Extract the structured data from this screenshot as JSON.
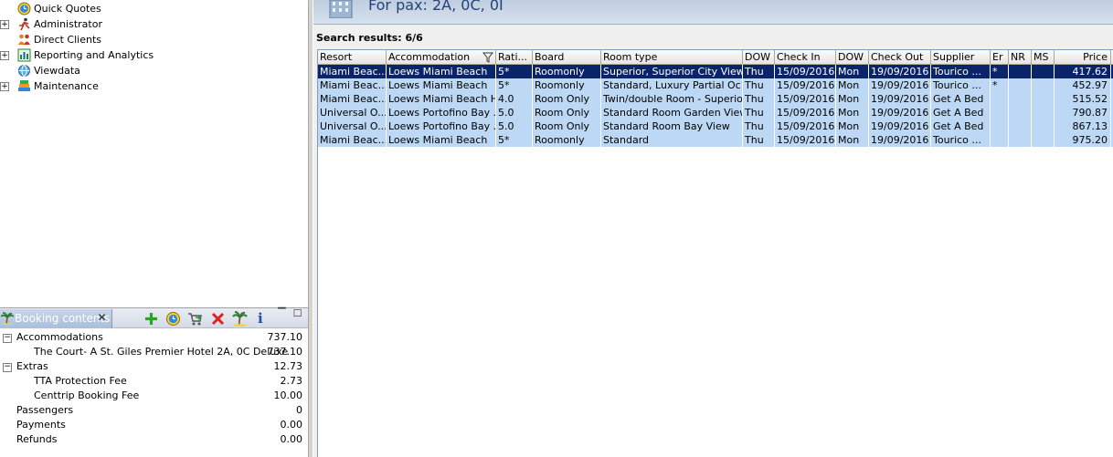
{
  "tree": {
    "items": [
      {
        "label": "Quick Quotes",
        "expander": "",
        "icon": "globe-clock-icon"
      },
      {
        "label": "Administrator",
        "expander": "+",
        "icon": "running-person-icon"
      },
      {
        "label": "Direct Clients",
        "expander": "",
        "icon": "people-icon"
      },
      {
        "label": "Reporting and Analytics",
        "expander": "+",
        "icon": "chart-report-icon"
      },
      {
        "label": "Viewdata",
        "expander": "",
        "icon": "viewdata-globe-icon"
      },
      {
        "label": "Maintenance",
        "expander": "+",
        "icon": "books-icon"
      }
    ]
  },
  "booking": {
    "tab_label": "Booking contents",
    "close_glyph": "✕",
    "toolbar": {
      "add": "✚",
      "info": "i",
      "minimize": "▔",
      "maximize": "☐"
    },
    "rows": [
      {
        "label": "Accommodations",
        "value": "737.10",
        "expander": "−",
        "indent": 18
      },
      {
        "label": "The Court- A St. Giles Premier Hotel  2A, 0C Deluxe",
        "value": "737.10",
        "expander": "",
        "indent": 37
      },
      {
        "label": "Extras",
        "value": "12.73",
        "expander": "−",
        "indent": 18
      },
      {
        "label": "TTA Protection Fee",
        "value": "2.73",
        "expander": "",
        "indent": 37
      },
      {
        "label": "Centtrip Booking Fee",
        "value": "10.00",
        "expander": "",
        "indent": 37
      },
      {
        "label": "Passengers",
        "value": "0",
        "expander": "",
        "indent": 18
      },
      {
        "label": "Payments",
        "value": "0.00",
        "expander": "",
        "indent": 18
      },
      {
        "label": "Refunds",
        "value": "0.00",
        "expander": "",
        "indent": 18
      }
    ]
  },
  "banner": {
    "text": "For pax: 2A, 0C, 0I"
  },
  "results": {
    "label": "Search results: 6/6"
  },
  "grid": {
    "columns": [
      "Resort",
      "Accommodation",
      "Rati...",
      "Board",
      "Room type",
      "DOW",
      "Check In",
      "DOW",
      "Check Out",
      "Supplier",
      "Er",
      "NR",
      "MS",
      "Price"
    ],
    "rows": [
      [
        "Miami Beac...",
        "Loews Miami Beach",
        "5*",
        "Roomonly",
        "Superior, Superior City View",
        "Thu",
        "15/09/2016",
        "Mon",
        "19/09/2016",
        "Tourico ...",
        "*",
        "",
        "",
        "417.62"
      ],
      [
        "Miami Beac...",
        "Loews Miami Beach",
        "5*",
        "Roomonly",
        "Standard, Luxury Partial Oc...",
        "Thu",
        "15/09/2016",
        "Mon",
        "19/09/2016",
        "Tourico ...",
        "*",
        "",
        "",
        "452.97"
      ],
      [
        "Miami Beac...",
        "Loews Miami Beach H...",
        "4.0",
        "Room Only",
        "Twin/double Room - Superior",
        "Thu",
        "15/09/2016",
        "Mon",
        "19/09/2016",
        "Get A Bed",
        "",
        "",
        "",
        "515.52"
      ],
      [
        "Universal O...",
        "Loews Portofino Bay ...",
        "5.0",
        "Room Only",
        "Standard Room Garden View",
        "Thu",
        "15/09/2016",
        "Mon",
        "19/09/2016",
        "Get A Bed",
        "",
        "",
        "",
        "790.87"
      ],
      [
        "Universal O...",
        "Loews Portofino Bay ...",
        "5.0",
        "Room Only",
        "Standard Room Bay View",
        "Thu",
        "15/09/2016",
        "Mon",
        "19/09/2016",
        "Get A Bed",
        "",
        "",
        "",
        "867.13"
      ],
      [
        "Miami Beac...",
        "Loews Miami Beach",
        "5*",
        "Roomonly",
        "Standard",
        "Thu",
        "15/09/2016",
        "Mon",
        "19/09/2016",
        "Tourico ...",
        "",
        "",
        "",
        "975.20"
      ]
    ],
    "selected_row": 0
  },
  "colors": {
    "selected_row": "#0a246a",
    "row_background": "#bcd8f4",
    "banner_text": "#24427a"
  }
}
